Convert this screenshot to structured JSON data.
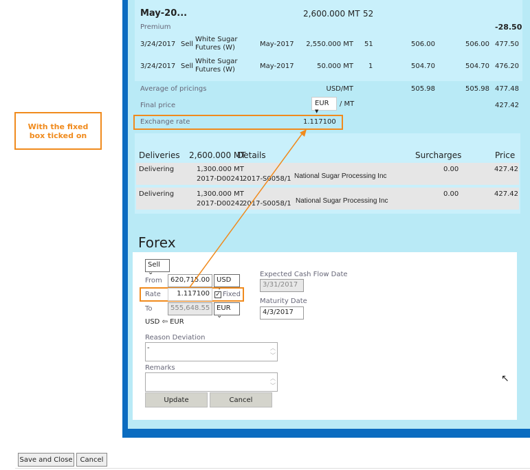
{
  "annotation": {
    "callout": "With the fixed box ticked on"
  },
  "summary": {
    "title": "May-20...",
    "quantity": "2,600.000 MT",
    "lots": "52",
    "premium_label": "Premium",
    "premium_value": "-28.50",
    "rows": [
      {
        "date": "3/24/2017",
        "side": "Sell",
        "instrument": "White Sugar Futures (W)",
        "month": "May-2017",
        "qty": "2,550.000 MT",
        "lots": "51",
        "price1": "506.00",
        "price2": "506.00",
        "price3": "477.50"
      },
      {
        "date": "3/24/2017",
        "side": "Sell",
        "instrument": "White Sugar Futures (W)",
        "month": "May-2017",
        "qty": "50.000 MT",
        "lots": "1",
        "price1": "504.70",
        "price2": "504.70",
        "price3": "476.20"
      }
    ],
    "average_label": "Average of pricings",
    "average_unit": "USD/MT",
    "average_p1": "505.98",
    "average_p2": "505.98",
    "average_p3": "477.48",
    "final_label": "Final price",
    "final_currency": "EUR",
    "final_unit": "/ MT",
    "final_value": "427.42",
    "exchange_label": "Exchange rate",
    "exchange_value": "1.117100"
  },
  "deliveries": {
    "header": {
      "label": "Deliveries",
      "qty": "2,600.000 MT",
      "details": "Details",
      "surcharges": "Surcharges",
      "price": "Price"
    },
    "rows": [
      {
        "status": "Delivering",
        "qty": "1,300.000 MT",
        "delivery_id": "2017-D00241",
        "contract": "2017-S0058/1",
        "counterparty": "National Sugar Processing Inc",
        "surcharges": "0.00",
        "price": "427.42"
      },
      {
        "status": "Delivering",
        "qty": "1,300.000 MT",
        "delivery_id": "2017-D00242",
        "contract": "2017-S0058/1",
        "counterparty": "National Sugar Processing Inc",
        "surcharges": "0.00",
        "price": "427.42"
      }
    ]
  },
  "forex": {
    "title": "Forex",
    "direction": "Sell",
    "from_label": "From",
    "from_value": "620,715.00",
    "from_currency": "USD",
    "rate_label": "Rate",
    "rate_value": "1.117100",
    "fixed_label": "Fixed",
    "fixed_checked": true,
    "to_label": "To",
    "to_value": "555,648.55",
    "to_currency": "EUR",
    "pair": "USD ⇦ EUR",
    "expected_label": "Expected Cash Flow Date",
    "expected_value": "3/31/2017",
    "maturity_label": "Maturity Date",
    "maturity_value": "4/3/2017",
    "reason_label": "Reason Deviation",
    "reason_value": "-",
    "remarks_label": "Remarks",
    "remarks_value": "",
    "update_label": "Update",
    "cancel_label": "Cancel"
  },
  "footer": {
    "save_close": "Save and Close",
    "cancel": "Cancel"
  },
  "colors": {
    "accent": "#f08a1c",
    "frame": "#0b6cc0",
    "panel": "#b9eaf6"
  }
}
